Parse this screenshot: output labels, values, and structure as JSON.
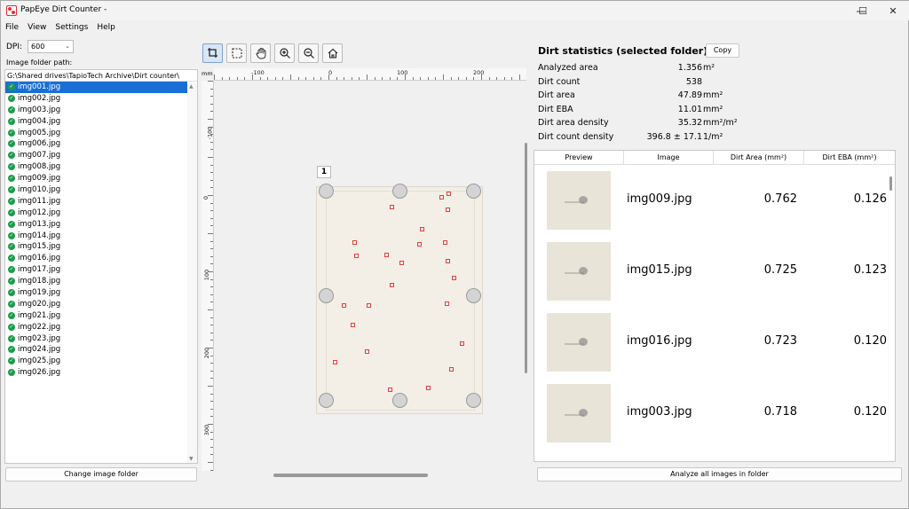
{
  "window": {
    "title": "PapEye Dirt Counter -",
    "minimize": "—",
    "maximize": "☐",
    "close": "✕"
  },
  "menu": [
    "File",
    "View",
    "Settings",
    "Help"
  ],
  "left": {
    "dpi_label": "DPI:",
    "dpi_value": "600",
    "folder_label": "Image folder path:",
    "folder_path": "G:\\Shared drives\\TapioTech Archive\\Dirt counter\\",
    "files": [
      "img001.jpg",
      "img002.jpg",
      "img003.jpg",
      "img004.jpg",
      "img005.jpg",
      "img006.jpg",
      "img007.jpg",
      "img008.jpg",
      "img009.jpg",
      "img010.jpg",
      "img011.jpg",
      "img012.jpg",
      "img013.jpg",
      "img014.jpg",
      "img015.jpg",
      "img016.jpg",
      "img017.jpg",
      "img018.jpg",
      "img019.jpg",
      "img020.jpg",
      "img021.jpg",
      "img022.jpg",
      "img023.jpg",
      "img024.jpg",
      "img025.jpg",
      "img026.jpg"
    ],
    "selected_file": "img001.jpg",
    "change_folder_button": "Change image folder"
  },
  "toolbar": {
    "tools": [
      {
        "name": "crop-tool",
        "icon": "crop-icon",
        "active": true
      },
      {
        "name": "select-tool",
        "icon": "dashed-rectangle-icon",
        "active": false
      },
      {
        "name": "pan-tool",
        "icon": "hand-icon",
        "active": false
      },
      {
        "name": "zoom-in-tool",
        "icon": "zoom-in-icon",
        "active": false
      },
      {
        "name": "zoom-out-tool",
        "icon": "zoom-out-icon",
        "active": false
      },
      {
        "name": "home-tool",
        "icon": "home-icon",
        "active": false
      }
    ]
  },
  "viewer": {
    "ruler_unit": "mm",
    "top_ticks": [
      "-100",
      "0",
      "100",
      "200"
    ],
    "left_ticks": [
      "-100",
      "0",
      "100",
      "200",
      "300"
    ],
    "crop_region_label": "1"
  },
  "stats": {
    "title": "Dirt statistics (selected folder)",
    "copy_button": "Copy",
    "rows": [
      {
        "label": "Analyzed area",
        "value": "1.356",
        "unit": "m²"
      },
      {
        "label": "Dirt count",
        "value": "538",
        "unit": ""
      },
      {
        "label": "Dirt area",
        "value": "47.89",
        "unit": "mm²"
      },
      {
        "label": "Dirt EBA",
        "value": "11.01",
        "unit": "mm²"
      },
      {
        "label": "Dirt area density",
        "value": "35.32",
        "unit": "mm²/m²"
      },
      {
        "label": "Dirt count density",
        "value": "396.8 ± 17.1",
        "unit": "1/m²"
      }
    ]
  },
  "table": {
    "headers": [
      "Preview",
      "Image",
      "Dirt Area (mm²)",
      "Dirt EBA (mm²)"
    ],
    "rows": [
      {
        "image": "img009.jpg",
        "area": "0.762",
        "eba": "0.126"
      },
      {
        "image": "img015.jpg",
        "area": "0.725",
        "eba": "0.123"
      },
      {
        "image": "img016.jpg",
        "area": "0.723",
        "eba": "0.120"
      },
      {
        "image": "img003.jpg",
        "area": "0.718",
        "eba": "0.120"
      }
    ]
  },
  "analyze_button": "Analyze all images in folder",
  "colors": {
    "selection": "#1a6fd6",
    "check": "#1a9c4a",
    "dirt_marker": "#e04040"
  }
}
